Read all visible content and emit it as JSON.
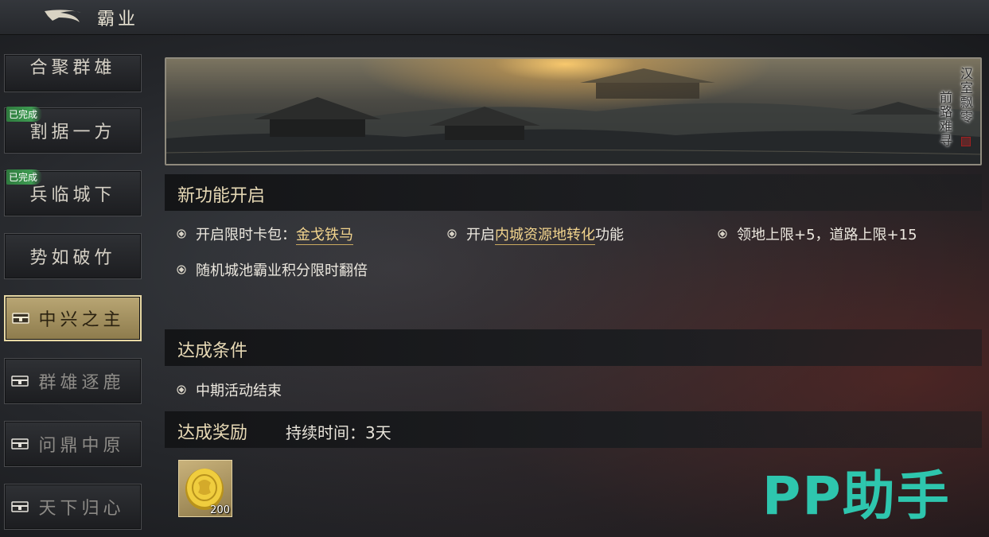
{
  "header": {
    "title": "霸业"
  },
  "nav": {
    "items": [
      {
        "label": "合聚群雄",
        "badge": "",
        "state": "normal"
      },
      {
        "label": "割据一方",
        "badge": "已完成",
        "state": "completed"
      },
      {
        "label": "兵临城下",
        "badge": "已完成",
        "state": "completed"
      },
      {
        "label": "势如破竹",
        "badge": "",
        "state": "normal"
      },
      {
        "label": "中兴之主",
        "badge": "",
        "state": "selected-locked"
      },
      {
        "label": "群雄逐鹿",
        "badge": "",
        "state": "locked"
      },
      {
        "label": "问鼎中原",
        "badge": "",
        "state": "locked"
      },
      {
        "label": "天下归心",
        "badge": "",
        "state": "locked"
      }
    ]
  },
  "banner": {
    "line1": "汉室飘零",
    "line2": "前路难寻"
  },
  "features": {
    "title": "新功能开启",
    "items": [
      {
        "prefix": "开启限时卡包：",
        "link": "金戈铁马",
        "suffix": ""
      },
      {
        "prefix": "开启",
        "link": "内城资源地转化",
        "suffix": "功能"
      },
      {
        "prefix": "领地上限+5，道路上限+15",
        "link": "",
        "suffix": ""
      },
      {
        "prefix": "随机城池霸业积分限时翻倍",
        "link": "",
        "suffix": ""
      }
    ]
  },
  "conditions": {
    "title": "达成条件",
    "items": [
      "中期活动结束"
    ]
  },
  "rewards": {
    "title": "达成奖励",
    "duration": "持续时间：3天",
    "items": [
      {
        "icon": "gold-coin-icon",
        "count": "200"
      }
    ]
  },
  "watermark": "PP助手",
  "colors": {
    "accent": "#e7d9b5",
    "link": "#f2d48d",
    "completed_badge": "#3e9b52",
    "selected_tab": "#b9a674",
    "watermark": "#2ec6ae"
  }
}
